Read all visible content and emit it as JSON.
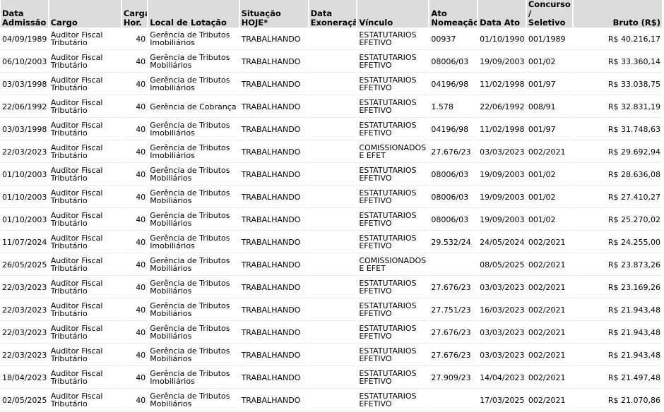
{
  "headers": {
    "admissao": "Data Admissão",
    "cargo": "Cargo",
    "carga": "Carga Hor.",
    "local": "Local de Lotação",
    "situacao": "Situação HOJE*",
    "exoneracao": "Data Exoneração",
    "vinculo": "Vínculo",
    "ato": "Ato Nomeação",
    "data_ato": "Data Ato",
    "concurso": "Concurso / Seletivo",
    "bruto": "Bruto (R$)"
  },
  "rows": [
    {
      "admissao": "04/09/1989",
      "cargo": "Auditor Fiscal Tributário",
      "carga": "40",
      "local": "Gerência de Tributos Imobiliários",
      "situacao": "TRABALHANDO",
      "exoneracao": "",
      "vinculo": "ESTATUTARIOS EFETIVO",
      "ato": "00937",
      "data_ato": "01/10/1990",
      "concurso": "001/1989",
      "bruto": "R$ 40.216,17"
    },
    {
      "admissao": "06/10/2003",
      "cargo": "Auditor Fiscal Tributário",
      "carga": "40",
      "local": "Gerência de Tributos Mobiliários",
      "situacao": "TRABALHANDO",
      "exoneracao": "",
      "vinculo": "ESTATUTARIOS EFETIVO",
      "ato": "08006/03",
      "data_ato": "19/09/2003",
      "concurso": "001/02",
      "bruto": "R$ 33.360,14"
    },
    {
      "admissao": "03/03/1998",
      "cargo": "Auditor Fiscal Tributário",
      "carga": "40",
      "local": "Gerência de Tributos Imobiliários",
      "situacao": "TRABALHANDO",
      "exoneracao": "",
      "vinculo": "ESTATUTARIOS EFETIVO",
      "ato": "04196/98",
      "data_ato": "11/02/1998",
      "concurso": "001/97",
      "bruto": "R$ 33.038,75"
    },
    {
      "admissao": "22/06/1992",
      "cargo": "Auditor Fiscal Tributário",
      "carga": "40",
      "local": "Gerência de Cobrança",
      "situacao": "TRABALHANDO",
      "exoneracao": "",
      "vinculo": "ESTATUTARIOS EFETIVO",
      "ato": "1.578",
      "data_ato": "22/06/1992",
      "concurso": "008/91",
      "bruto": "R$ 32.831,19"
    },
    {
      "admissao": "03/03/1998",
      "cargo": "Auditor Fiscal Tributário",
      "carga": "40",
      "local": "Gerência de Tributos Imobiliários",
      "situacao": "TRABALHANDO",
      "exoneracao": "",
      "vinculo": "ESTATUTARIOS EFETIVO",
      "ato": "04196/98",
      "data_ato": "11/02/1998",
      "concurso": "001/97",
      "bruto": "R$ 31.748,63"
    },
    {
      "admissao": "22/03/2023",
      "cargo": "Auditor Fiscal Tributário",
      "carga": "40",
      "local": "Gerência de Tributos Imobiliários",
      "situacao": "TRABALHANDO",
      "exoneracao": "",
      "vinculo": "COMISSIONADOS E EFET",
      "ato": "27.676/23",
      "data_ato": "03/03/2023",
      "concurso": "002/2021",
      "bruto": "R$ 29.692,94"
    },
    {
      "admissao": "01/10/2003",
      "cargo": "Auditor Fiscal Tributário",
      "carga": "40",
      "local": "Gerência de Tributos Mobiliários",
      "situacao": "TRABALHANDO",
      "exoneracao": "",
      "vinculo": "ESTATUTARIOS EFETIVO",
      "ato": "08006/03",
      "data_ato": "19/09/2003",
      "concurso": "001/02",
      "bruto": "R$ 28.636,08"
    },
    {
      "admissao": "01/10/2003",
      "cargo": "Auditor Fiscal Tributário",
      "carga": "40",
      "local": "Gerência de Tributos Mobiliários",
      "situacao": "TRABALHANDO",
      "exoneracao": "",
      "vinculo": "ESTATUTARIOS EFETIVO",
      "ato": "08006/03",
      "data_ato": "19/09/2003",
      "concurso": "001/02",
      "bruto": "R$ 27.410,27"
    },
    {
      "admissao": "01/10/2003",
      "cargo": "Auditor Fiscal Tributário",
      "carga": "40",
      "local": "Gerência de Tributos Mobiliários",
      "situacao": "TRABALHANDO",
      "exoneracao": "",
      "vinculo": "ESTATUTARIOS EFETIVO",
      "ato": "08006/03",
      "data_ato": "19/09/2003",
      "concurso": "001/02",
      "bruto": "R$ 25.270,02"
    },
    {
      "admissao": "11/07/2024",
      "cargo": "Auditor Fiscal Tributário",
      "carga": "40",
      "local": "Gerência de Tributos Imobiliários",
      "situacao": "TRABALHANDO",
      "exoneracao": "",
      "vinculo": "ESTATUTARIOS EFETIVO",
      "ato": "29.532/24",
      "data_ato": "24/05/2024",
      "concurso": "002/2021",
      "bruto": "R$ 24.255,00"
    },
    {
      "admissao": "26/05/2025",
      "cargo": "Auditor Fiscal Tributário",
      "carga": "40",
      "local": "Gerência de Tributos Mobiliários",
      "situacao": "TRABALHANDO",
      "exoneracao": "",
      "vinculo": "COMISSIONADOS E EFET",
      "ato": "",
      "data_ato": "08/05/2025",
      "concurso": "002/2021",
      "bruto": "R$ 23.873,26"
    },
    {
      "admissao": "22/03/2023",
      "cargo": "Auditor Fiscal Tributário",
      "carga": "40",
      "local": "Gerência de Tributos Mobiliários",
      "situacao": "TRABALHANDO",
      "exoneracao": "",
      "vinculo": "ESTATUTARIOS EFETIVO",
      "ato": "27.676/23",
      "data_ato": "03/03/2023",
      "concurso": "002/2021",
      "bruto": "R$ 23.169,26"
    },
    {
      "admissao": "22/03/2023",
      "cargo": "Auditor Fiscal Tributário",
      "carga": "40",
      "local": "Gerência de Tributos Mobiliários",
      "situacao": "TRABALHANDO",
      "exoneracao": "",
      "vinculo": "ESTATUTARIOS EFETIVO",
      "ato": "27.751/23",
      "data_ato": "16/03/2023",
      "concurso": "002/2021",
      "bruto": "R$ 21.943,48"
    },
    {
      "admissao": "22/03/2023",
      "cargo": "Auditor Fiscal Tributário",
      "carga": "40",
      "local": "Gerência de Tributos Mobiliários",
      "situacao": "TRABALHANDO",
      "exoneracao": "",
      "vinculo": "ESTATUTARIOS EFETIVO",
      "ato": "27.676/23",
      "data_ato": "03/03/2023",
      "concurso": "002/2021",
      "bruto": "R$ 21.943,48"
    },
    {
      "admissao": "22/03/2023",
      "cargo": "Auditor Fiscal Tributário",
      "carga": "40",
      "local": "Gerência de Tributos Mobiliários",
      "situacao": "TRABALHANDO",
      "exoneracao": "",
      "vinculo": "ESTATUTARIOS EFETIVO",
      "ato": "27.676/23",
      "data_ato": "03/03/2023",
      "concurso": "002/2021",
      "bruto": "R$ 21.943,48"
    },
    {
      "admissao": "18/04/2023",
      "cargo": "Auditor Fiscal Tributário",
      "carga": "40",
      "local": "Gerência de Tributos Imobiliários",
      "situacao": "TRABALHANDO",
      "exoneracao": "",
      "vinculo": "ESTATUTARIOS EFETIVO",
      "ato": "27.909/23",
      "data_ato": "14/04/2023",
      "concurso": "002/2021",
      "bruto": "R$ 21.497,48"
    },
    {
      "admissao": "02/05/2025",
      "cargo": "Auditor Fiscal Tributário",
      "carga": "40",
      "local": "Gerência de Tributos Mobiliários",
      "situacao": "TRABALHANDO",
      "exoneracao": "",
      "vinculo": "ESTATUTARIOS EFETIVO",
      "ato": "",
      "data_ato": "17/03/2025",
      "concurso": "002/2021",
      "bruto": "R$ 21.070,86"
    }
  ]
}
